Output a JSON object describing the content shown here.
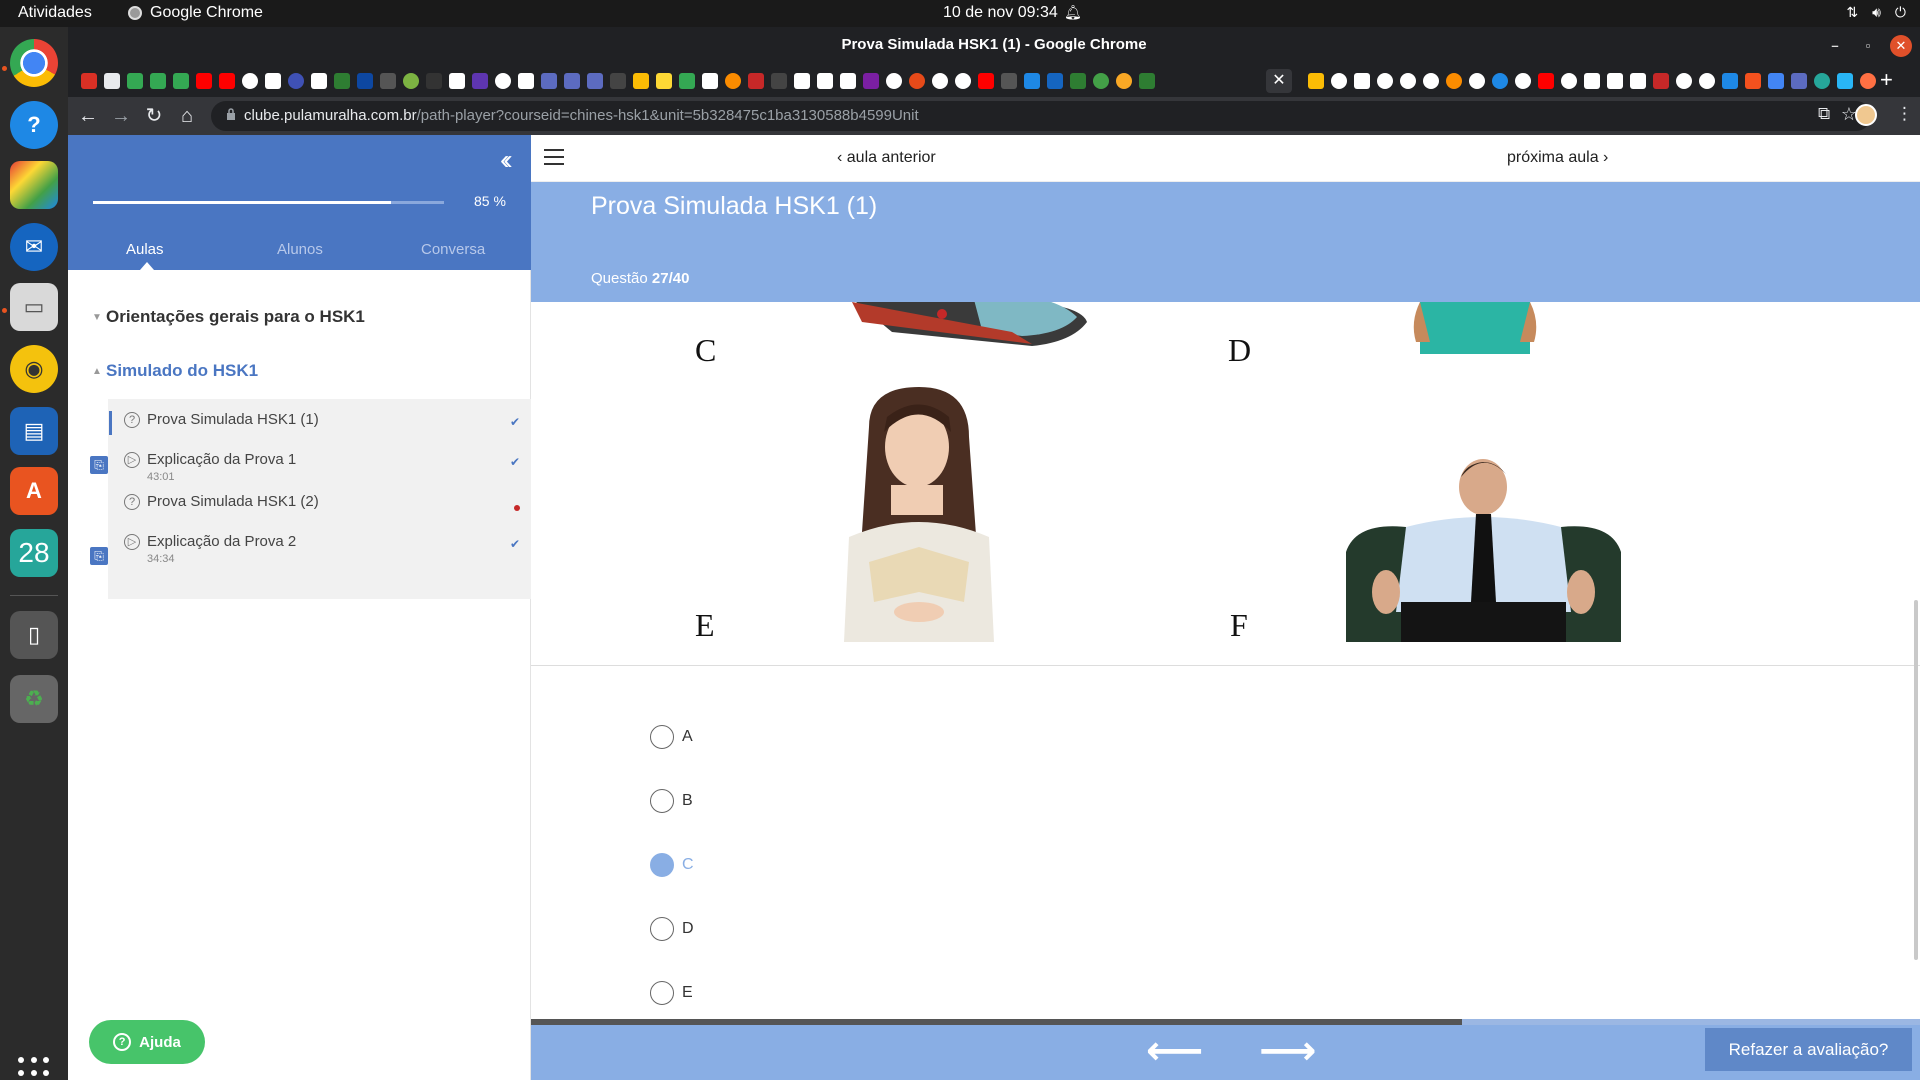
{
  "os": {
    "activities": "Atividades",
    "app_name": "Google Chrome",
    "clock": "10 de nov  09:34"
  },
  "window": {
    "title": "Prova Simulada HSK1 (1) - Google Chrome"
  },
  "browser": {
    "url_host": "clube.pulamuralha.com.br",
    "url_path": "/path-player?courseid=chines-hsk1&unit=5b328475c1ba3130588b4599Unit"
  },
  "sidebar": {
    "progress_percent": 85,
    "progress_label": "85 %",
    "tabs": [
      {
        "label": "Aulas",
        "active": true
      },
      {
        "label": "Alunos",
        "active": false
      },
      {
        "label": "Conversa",
        "active": false
      }
    ],
    "sections": [
      {
        "title": "Orientações gerais para o HSK1",
        "open": false
      },
      {
        "title": "Simulado do HSK1",
        "open": true
      }
    ],
    "lessons": [
      {
        "title": "Prova Simulada HSK1 (1)",
        "duration": "",
        "status": "done",
        "current": true,
        "type": "quiz"
      },
      {
        "title": "Explicação da Prova 1",
        "duration": "43:01",
        "status": "done",
        "current": false,
        "type": "video"
      },
      {
        "title": "Prova Simulada HSK1 (2)",
        "duration": "",
        "status": "pending",
        "current": false,
        "type": "quiz"
      },
      {
        "title": "Explicação da Prova 2",
        "duration": "34:34",
        "status": "done",
        "current": false,
        "type": "video"
      }
    ],
    "help_label": "Ajuda"
  },
  "main": {
    "prev_label": "aula anterior",
    "next_label": "próxima aula",
    "quiz_title": "Prova Simulada HSK1 (1)",
    "question_prefix": "Questão",
    "question_number": "27/40",
    "image_letters": [
      "C",
      "D",
      "E",
      "F"
    ],
    "options": [
      {
        "label": "A",
        "selected": false
      },
      {
        "label": "B",
        "selected": false
      },
      {
        "label": "C",
        "selected": true
      },
      {
        "label": "D",
        "selected": false
      },
      {
        "label": "E",
        "selected": false
      }
    ],
    "quiz_progress_fraction": 0.67,
    "redo_label": "Refazer a avaliação?"
  },
  "colors": {
    "accent": "#4a76c2",
    "header_light": "#89aee4",
    "help_green": "#47c46a"
  }
}
